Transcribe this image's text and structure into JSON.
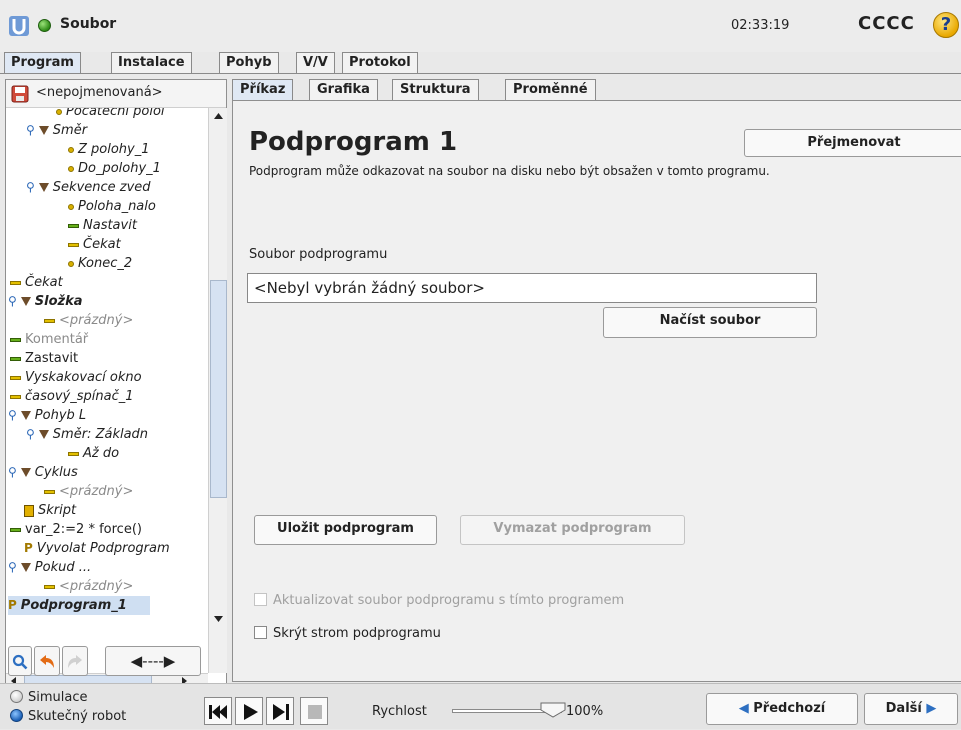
{
  "title_bar": {
    "file_title": "Soubor",
    "clock": "02:33:19",
    "robot_name": "CCCC",
    "help_glyph": "?"
  },
  "main_tabs": [
    {
      "label": "Program",
      "active": true
    },
    {
      "label": "Instalace",
      "active": false
    },
    {
      "label": "Pohyb",
      "active": false
    },
    {
      "label": "V/V",
      "active": false
    },
    {
      "label": "Protokol",
      "active": false
    }
  ],
  "left_panel": {
    "program_name": "<nepojmenovaná>",
    "tree": [
      {
        "label": "Počáteční polol",
        "icon": "waypoint-icon"
      },
      {
        "label": "Směr",
        "icon": "direction-icon"
      },
      {
        "label": "Z polohy_1",
        "icon": "waypoint-icon"
      },
      {
        "label": "Do_polohy_1",
        "icon": "waypoint-icon"
      },
      {
        "label": "Sekvence zved",
        "icon": "sequence-icon"
      },
      {
        "label": "Poloha_nalo",
        "icon": "waypoint-icon"
      },
      {
        "label": "Nastavit",
        "icon": "set-icon"
      },
      {
        "label": "Čekat",
        "icon": "wait-icon"
      },
      {
        "label": "Konec_2",
        "icon": "waypoint-icon"
      },
      {
        "label": "Čekat",
        "icon": "wait-icon"
      },
      {
        "label": "Složka",
        "icon": "folder-icon"
      },
      {
        "label": "<prázdný>",
        "icon": "empty-icon"
      },
      {
        "label": "Komentář",
        "icon": "comment-icon"
      },
      {
        "label": "Zastavit",
        "icon": "halt-icon"
      },
      {
        "label": "Vyskakovací okno",
        "icon": "popup-icon"
      },
      {
        "label": "časový_spínač_1",
        "icon": "timer-icon"
      },
      {
        "label": "Pohyb L",
        "icon": "move-icon"
      },
      {
        "label": "Směr: Základn",
        "icon": "direction-icon"
      },
      {
        "label": "Až do",
        "icon": "until-icon"
      },
      {
        "label": "Cyklus",
        "icon": "loop-icon"
      },
      {
        "label": "<prázdný>",
        "icon": "empty-icon"
      },
      {
        "label": "Skript",
        "icon": "script-icon"
      },
      {
        "label": "var_2:=2 * force()",
        "icon": "assignment-icon"
      },
      {
        "label": "Vyvolat Podprogram",
        "icon": "call-subprogram-icon"
      },
      {
        "label": "Pokud ...",
        "icon": "if-icon"
      },
      {
        "label": "<prázdný>",
        "icon": "empty-icon"
      },
      {
        "label": "Podprogram_1",
        "icon": "subprogram-icon"
      }
    ],
    "toolbar": {
      "search_icon": "search-icon",
      "undo_icon": "undo-icon",
      "redo_icon": "redo-icon",
      "move_label": "◀----▶"
    }
  },
  "sub_tabs": [
    {
      "label": "Příkaz",
      "active": true
    },
    {
      "label": "Grafika",
      "active": false
    },
    {
      "label": "Struktura",
      "active": false
    },
    {
      "label": "Proměnné",
      "active": false
    }
  ],
  "content": {
    "heading": "Podprogram 1",
    "description": "Podprogram může odkazovat na soubor na disku nebo být obsažen v tomto programu.",
    "rename_button": "Přejmenovat",
    "subfile_label": "Soubor podprogramu",
    "subfile_value": "<Nebyl vybrán žádný soubor>",
    "load_button": "Načíst soubor",
    "save_button": "Uložit podprogram",
    "delete_button": "Vymazat podprogram",
    "checkbox_update": {
      "label": "Aktualizovat soubor podprogramu s tímto programem",
      "checked": false,
      "enabled": false
    },
    "checkbox_hide": {
      "label": "Skrýt strom podprogramu",
      "checked": false,
      "enabled": true
    }
  },
  "footer": {
    "mode_simulation": "Simulace",
    "mode_real": "Skutečný robot",
    "speed_label": "Rychlost",
    "speed_value": "100%",
    "speed_fraction": 1.0,
    "prev_button": "Předchozí",
    "next_button": "Další"
  },
  "colors": {
    "accent": "#dfe8f4",
    "tab_active": "#dfe8f4",
    "selected_row": "#cfdff2",
    "status_green": "#2e8b16"
  }
}
